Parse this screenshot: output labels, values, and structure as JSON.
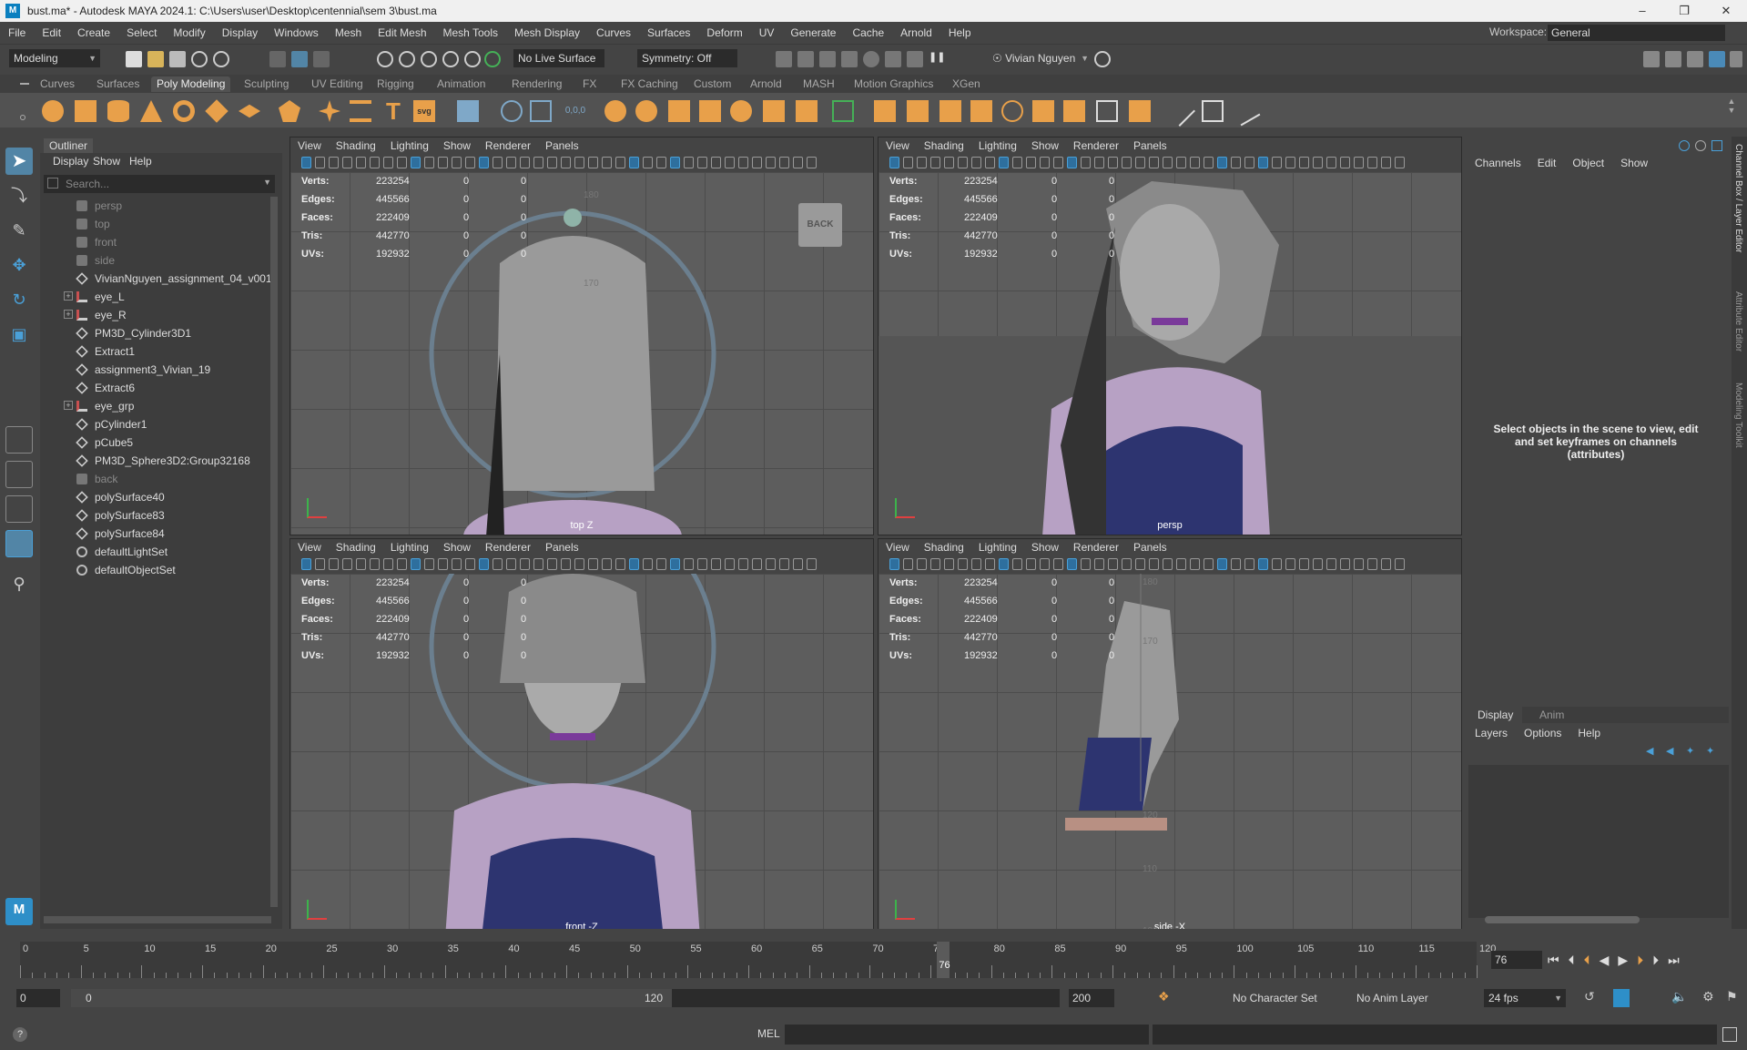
{
  "window": {
    "title": "bust.ma* - Autodesk MAYA 2024.1: C:\\Users\\user\\Desktop\\centennial\\sem 3\\bust.ma",
    "logo": "M"
  },
  "menus": [
    "File",
    "Edit",
    "Create",
    "Select",
    "Modify",
    "Display",
    "Windows",
    "Mesh",
    "Edit Mesh",
    "Mesh Tools",
    "Mesh Display",
    "Curves",
    "Surfaces",
    "Deform",
    "UV",
    "Generate",
    "Cache",
    "Arnold",
    "Help"
  ],
  "workspace": {
    "label": "Workspace:",
    "value": "General"
  },
  "status": {
    "mode": "Modeling",
    "live_surface": "No Live Surface",
    "symmetry": "Symmetry: Off",
    "user": "Vivian Nguyen"
  },
  "shelf_tabs": [
    "Curves",
    "Surfaces",
    "Poly Modeling",
    "Sculpting",
    "UV Editing",
    "Rigging",
    "Animation",
    "Rendering",
    "FX",
    "FX Caching",
    "Custom",
    "Arnold",
    "MASH",
    "Motion Graphics",
    "XGen"
  ],
  "shelf_active": "Poly Modeling",
  "outliner": {
    "title": "Outliner",
    "menu": [
      "Display",
      "Show",
      "Help"
    ],
    "search_placeholder": "Search...",
    "items": [
      {
        "name": "persp",
        "dim": true,
        "type": "camera"
      },
      {
        "name": "top",
        "dim": true,
        "type": "camera"
      },
      {
        "name": "front",
        "dim": true,
        "type": "camera"
      },
      {
        "name": "side",
        "dim": true,
        "type": "camera"
      },
      {
        "name": "VivianNguyen_assignment_04_v001",
        "type": "mesh"
      },
      {
        "name": "eye_L",
        "type": "joint",
        "expand": true
      },
      {
        "name": "eye_R",
        "type": "joint",
        "expand": true
      },
      {
        "name": "PM3D_Cylinder3D1",
        "type": "mesh"
      },
      {
        "name": "Extract1",
        "type": "mesh"
      },
      {
        "name": "assignment3_Vivian_19",
        "type": "mesh"
      },
      {
        "name": "Extract6",
        "type": "mesh"
      },
      {
        "name": "eye_grp",
        "type": "joint",
        "expand": true
      },
      {
        "name": "pCylinder1",
        "type": "mesh"
      },
      {
        "name": "pCube5",
        "type": "mesh"
      },
      {
        "name": "PM3D_Sphere3D2:Group32168",
        "type": "mesh"
      },
      {
        "name": "back",
        "dim": true,
        "type": "camera"
      },
      {
        "name": "polySurface40",
        "type": "mesh"
      },
      {
        "name": "polySurface83",
        "type": "mesh"
      },
      {
        "name": "polySurface84",
        "type": "mesh"
      },
      {
        "name": "defaultLightSet",
        "type": "set"
      },
      {
        "name": "defaultObjectSet",
        "type": "set"
      }
    ]
  },
  "viewport_menu": [
    "View",
    "Shading",
    "Lighting",
    "Show",
    "Renderer",
    "Panels"
  ],
  "hud": [
    {
      "k": "Verts:",
      "v": "223254",
      "a": "0",
      "b": "0"
    },
    {
      "k": "Edges:",
      "v": "445566",
      "a": "0",
      "b": "0"
    },
    {
      "k": "Faces:",
      "v": "222409",
      "a": "0",
      "b": "0"
    },
    {
      "k": "Tris:",
      "v": "442770",
      "a": "0",
      "b": "0"
    },
    {
      "k": "UVs:",
      "v": "192932",
      "a": "0",
      "b": "0"
    }
  ],
  "viewports": [
    {
      "label": "top Z",
      "cube": "BACK",
      "ticks": [
        "180",
        "170"
      ]
    },
    {
      "label": "persp"
    },
    {
      "label": "front -Z"
    },
    {
      "label": "side -X",
      "ticks": [
        "180",
        "170",
        "120",
        "110",
        "100"
      ]
    }
  ],
  "channel_box": {
    "menu": [
      "Channels",
      "Edit",
      "Object",
      "Show"
    ],
    "empty_msg": "Select objects in the scene to view, edit and set keyframes on channels (attributes)",
    "side_tabs": [
      "Channel Box / Layer Editor",
      "Attribute Editor",
      "Modeling Toolkit"
    ]
  },
  "layer_editor": {
    "tabs": [
      "Display",
      "Anim"
    ],
    "menu": [
      "Layers",
      "Options",
      "Help"
    ]
  },
  "timeline": {
    "ticks": [
      "0",
      "5",
      "10",
      "15",
      "20",
      "25",
      "30",
      "35",
      "40",
      "45",
      "50",
      "55",
      "60",
      "65",
      "70",
      "75",
      "80",
      "85",
      "90",
      "95",
      "100",
      "105",
      "110",
      "115",
      "120"
    ],
    "current_frame": "76",
    "current_field": "76"
  },
  "range": {
    "start": "0",
    "range_start": "0",
    "range_end": "120",
    "end": "200",
    "character_set": "No Character Set",
    "anim_layer": "No Anim Layer",
    "fps": "24 fps"
  },
  "cmdline": {
    "label": "MEL",
    "help": "?"
  },
  "colors": {
    "accent": "#5285a6",
    "shelf_orange": "#e8a04a",
    "active_blue": "#2e8fc8"
  }
}
